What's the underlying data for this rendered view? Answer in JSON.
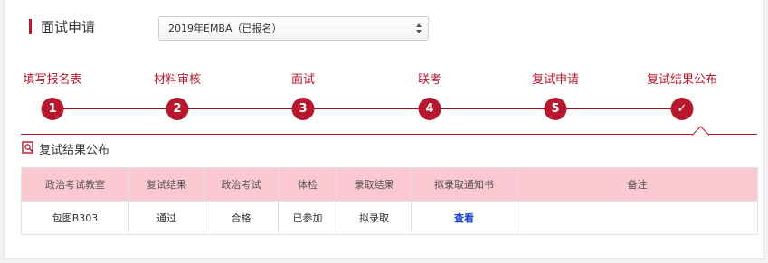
{
  "page": {
    "title": "面试申请"
  },
  "batch_select": {
    "value": "2019年EMBA（已报名）"
  },
  "steps": [
    {
      "label": "填写报名表",
      "marker": "1"
    },
    {
      "label": "材料审核",
      "marker": "2"
    },
    {
      "label": "面试",
      "marker": "3"
    },
    {
      "label": "联考",
      "marker": "4"
    },
    {
      "label": "复试申请",
      "marker": "5"
    },
    {
      "label": "复试结果公布",
      "marker": "✓"
    }
  ],
  "section": {
    "title": "复试结果公布",
    "icon": "search-document-icon"
  },
  "table": {
    "headers": [
      "政治考试教室",
      "复试结果",
      "政治考试",
      "体检",
      "录取结果",
      "拟录取通知书",
      "备注"
    ],
    "row": [
      "包图B303",
      "通过",
      "合格",
      "已参加",
      "拟录取",
      "查看",
      ""
    ]
  },
  "colors": {
    "accent": "#b8182d",
    "header_bg": "#fac8d0",
    "link": "#1a3ed6"
  }
}
